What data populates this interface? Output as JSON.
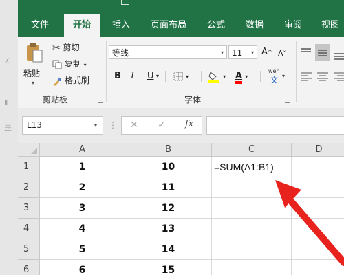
{
  "app": {
    "accent": "#217346",
    "side_glyphs": [
      "∠",
      "Ⅱ",
      "昰"
    ]
  },
  "tabs": [
    {
      "label": "文件",
      "active": false
    },
    {
      "label": "开始",
      "active": true
    },
    {
      "label": "插入",
      "active": false
    },
    {
      "label": "页面布局",
      "active": false
    },
    {
      "label": "公式",
      "active": false
    },
    {
      "label": "数据",
      "active": false
    },
    {
      "label": "审阅",
      "active": false
    },
    {
      "label": "视图",
      "active": false
    }
  ],
  "ribbon": {
    "clipboard": {
      "paste_label": "粘贴",
      "cut_label": "剪切",
      "copy_label": "复制",
      "format_painter_label": "格式刷",
      "group_label": "剪贴板"
    },
    "font": {
      "font_name": "等线",
      "font_size": "11",
      "grow_label": "A",
      "shrink_label": "A",
      "bold_label": "B",
      "italic_label": "I",
      "underline_label": "U",
      "font_color_label": "A",
      "phonetic_label": "wén",
      "phonetic_char": "文",
      "group_label": "字体",
      "highlight_color": "#ffff00",
      "font_color": "#ff0000"
    }
  },
  "formula_bar": {
    "name_box": "L13",
    "cancel_symbol": "✕",
    "enter_symbol": "✓",
    "fx_label": "fx",
    "formula_value": ""
  },
  "sheet": {
    "columns": [
      "A",
      "B",
      "C",
      "D"
    ],
    "rows": [
      {
        "num": "1",
        "a": "1",
        "b": "10",
        "c": "=SUM(A1:B1)"
      },
      {
        "num": "2",
        "a": "2",
        "b": "11",
        "c": ""
      },
      {
        "num": "3",
        "a": "3",
        "b": "12",
        "c": ""
      },
      {
        "num": "4",
        "a": "4",
        "b": "13",
        "c": ""
      },
      {
        "num": "5",
        "a": "5",
        "b": "14",
        "c": ""
      },
      {
        "num": "6",
        "a": "6",
        "b": "15",
        "c": ""
      }
    ],
    "annotation_arrow_color": "#e8231d"
  }
}
